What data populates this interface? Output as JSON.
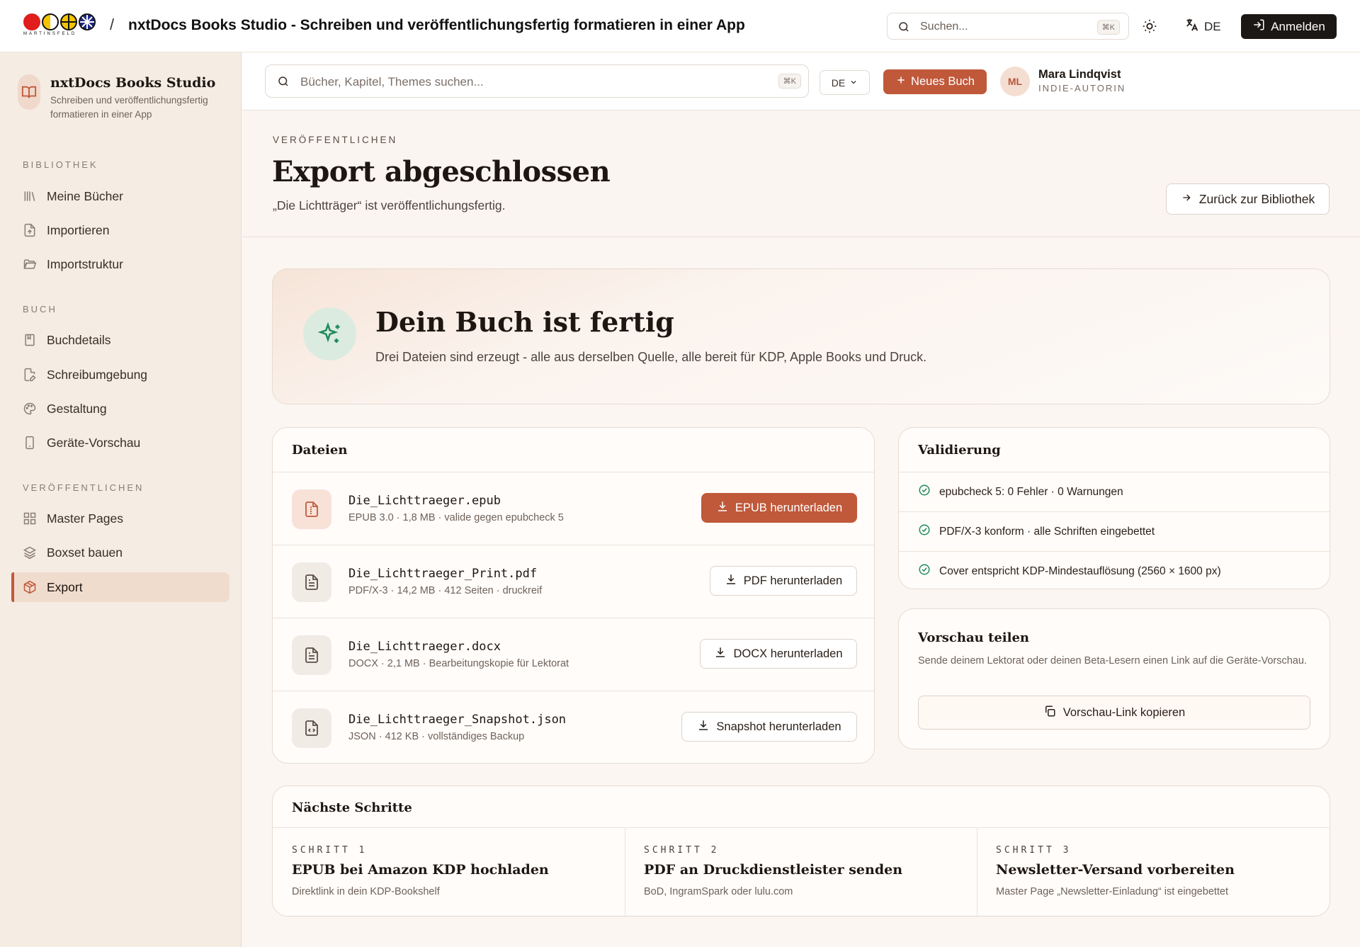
{
  "topbar": {
    "logo_wordmark": "MARTINSFELD",
    "separator": "/",
    "app_title": "nxtDocs Books Studio - Schreiben und veröffentlichungsfertig formatieren in einer App",
    "search_placeholder": "Suchen...",
    "search_shortcut": "⌘K",
    "language": "DE",
    "login_label": "Anmelden"
  },
  "sidebar": {
    "brand_name": "nxtDocs Books Studio",
    "brand_sub": "Schreiben und veröffentlichungsfertig formatieren in einer App",
    "sections": [
      {
        "label": "BIBLIOTHEK",
        "items": [
          {
            "label": "Meine Bücher",
            "icon": "library-icon"
          },
          {
            "label": "Importieren",
            "icon": "file-import-icon"
          },
          {
            "label": "Importstruktur",
            "icon": "folder-open-icon"
          }
        ]
      },
      {
        "label": "BUCH",
        "items": [
          {
            "label": "Buchdetails",
            "icon": "book-icon"
          },
          {
            "label": "Schreibumgebung",
            "icon": "file-pen-icon"
          },
          {
            "label": "Gestaltung",
            "icon": "palette-icon"
          },
          {
            "label": "Geräte-Vorschau",
            "icon": "smartphone-icon"
          }
        ]
      },
      {
        "label": "VERÖFFENTLICHEN",
        "items": [
          {
            "label": "Master Pages",
            "icon": "grid-icon"
          },
          {
            "label": "Boxset bauen",
            "icon": "layers-icon"
          },
          {
            "label": "Export",
            "icon": "package-icon",
            "active": true
          }
        ]
      }
    ]
  },
  "mainbar": {
    "search_placeholder": "Bücher, Kapitel, Themes suchen...",
    "search_shortcut": "⌘K",
    "language": "DE",
    "new_book_label": "Neues Buch",
    "avatar_initials": "ML",
    "user_name": "Mara Lindqvist",
    "user_role": "INDIE-AUTORIN"
  },
  "page": {
    "eyebrow": "VERÖFFENTLICHEN",
    "title": "Export abgeschlossen",
    "subtitle": "„Die Lichtträger“ ist veröffentlichungsfertig.",
    "back_label": "Zurück zur Bibliothek"
  },
  "hero": {
    "title": "Dein Buch ist fertig",
    "subtitle": "Drei Dateien sind erzeugt - alle aus derselben Quelle, alle bereit für KDP, Apple Books und Druck."
  },
  "files": {
    "title": "Dateien",
    "items": [
      {
        "name": "Die_Lichttraeger.epub",
        "meta": "EPUB 3.0 · 1,8 MB · valide gegen epubcheck 5",
        "button": "EPUB herunterladen",
        "icon": "file-epub-icon"
      },
      {
        "name": "Die_Lichttraeger_Print.pdf",
        "meta": "PDF/X-3 · 14,2 MB · 412 Seiten · druckreif",
        "button": "PDF herunterladen",
        "icon": "file-text-icon"
      },
      {
        "name": "Die_Lichttraeger.docx",
        "meta": "DOCX · 2,1 MB · Bearbeitungskopie für Lektorat",
        "button": "DOCX herunterladen",
        "icon": "file-text-icon"
      },
      {
        "name": "Die_Lichttraeger_Snapshot.json",
        "meta": "JSON · 412 KB · vollständiges Backup",
        "button": "Snapshot herunterladen",
        "icon": "file-code-icon"
      }
    ]
  },
  "validation": {
    "title": "Validierung",
    "items": [
      "epubcheck 5: 0 Fehler · 0 Warnungen",
      "PDF/X-3 konform · alle Schriften eingebettet",
      "Cover entspricht KDP-Mindestauflösung (2560 × 1600 px)"
    ]
  },
  "share": {
    "title": "Vorschau teilen",
    "description": "Sende deinem Lektorat oder deinen Beta-Lesern einen Link auf die Geräte-Vorschau.",
    "button": "Vorschau-Link kopieren"
  },
  "next_steps": {
    "title": "Nächste Schritte",
    "steps": [
      {
        "label": "SCHRITT 1",
        "title": "EPUB bei Amazon KDP hochladen",
        "desc": "Direktlink in dein KDP-Bookshelf"
      },
      {
        "label": "SCHRITT 2",
        "title": "PDF an Druckdienstleister senden",
        "desc": "BoD, IngramSpark oder lulu.com"
      },
      {
        "label": "SCHRITT 3",
        "title": "Newsletter-Versand vorbereiten",
        "desc": "Master Page „Newsletter-Einladung“ ist eingebettet"
      }
    ]
  },
  "colors": {
    "accent": "#c0583a",
    "success": "#1f8a5b",
    "dark": "#1b1714"
  }
}
